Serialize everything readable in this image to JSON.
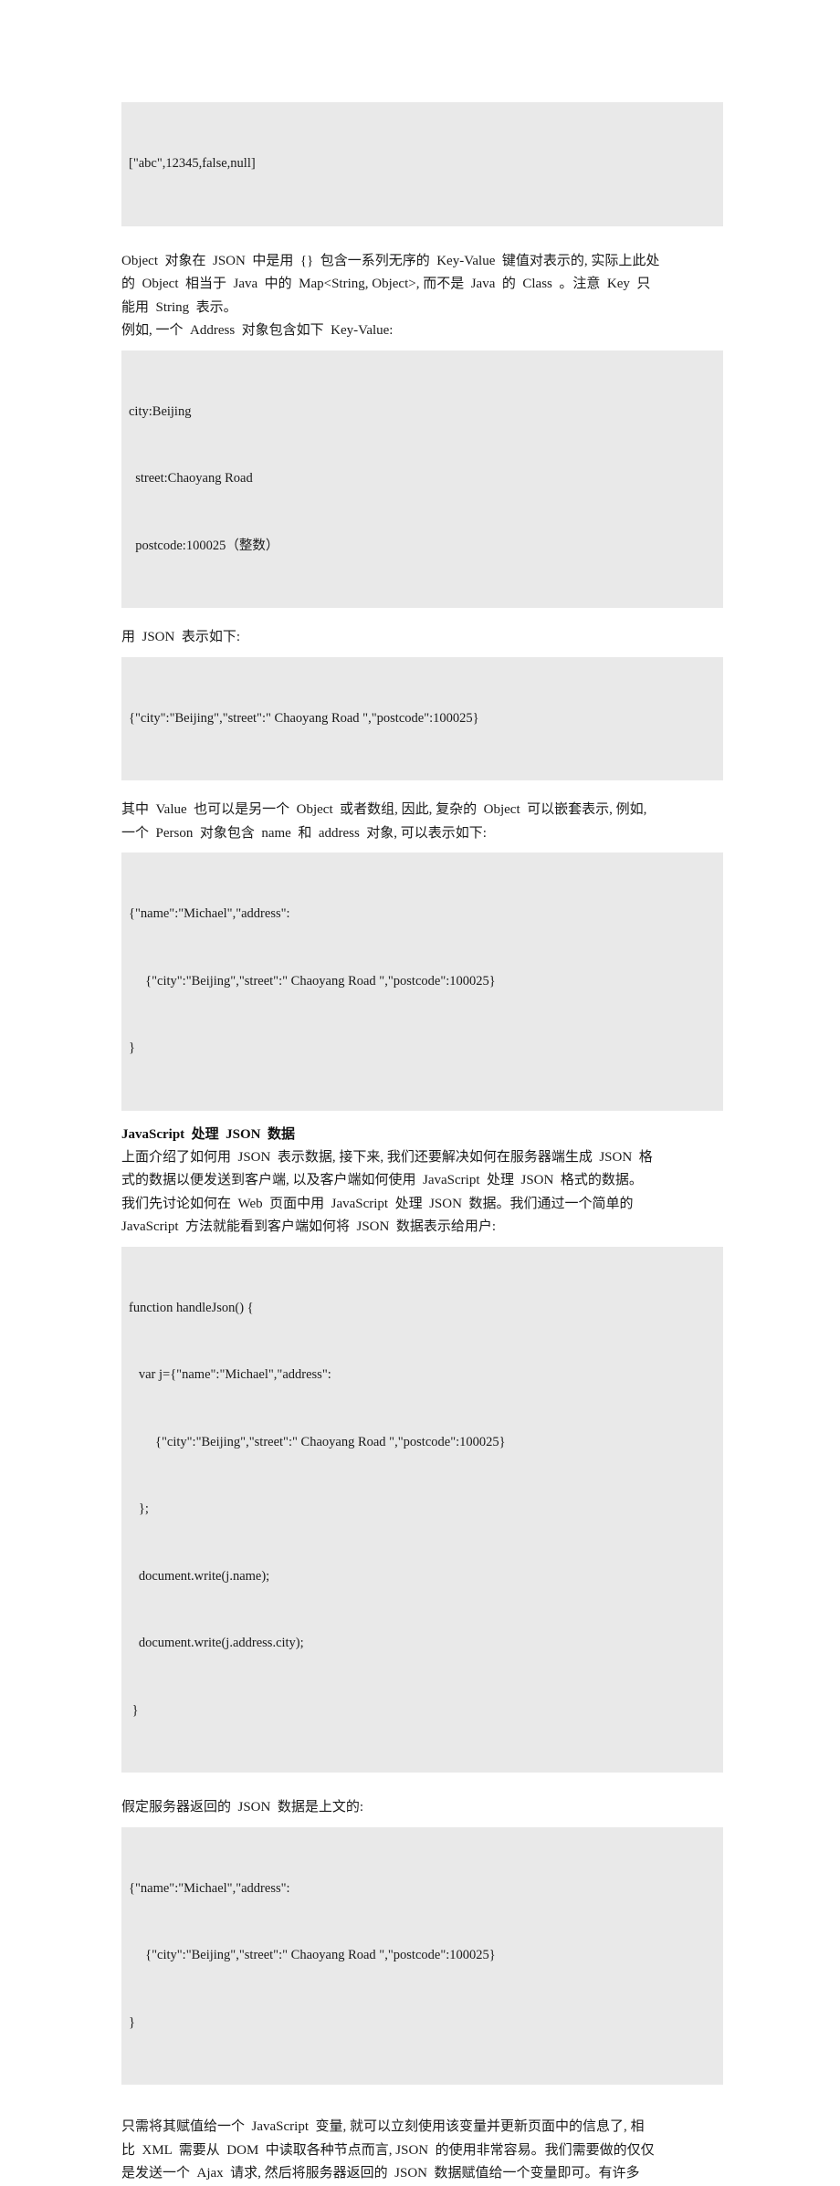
{
  "document": {
    "page_background": "#ffffff",
    "code_block_background": "#e9e9e9",
    "text_color": "#1a1a1a"
  },
  "blocks": {
    "array_example": {
      "line1": "[\"abc\",12345,false,null]"
    },
    "object_paragraph": {
      "line1": "Object  对象在  JSON  中是用  {}  包含一系列无序的  Key-Value  键值对表示的, 实际上此处",
      "line2": "的  Object  相当于  Java  中的  Map<String, Object>, 而不是  Java  的  Class  。注意  Key  只",
      "line3": "能用  String  表示。",
      "line4": "例如, 一个  Address  对象包含如下  Key-Value:"
    },
    "address_keyvalue": {
      "line1": "city:Beijing",
      "line2": "  street:Chaoyang Road",
      "line3": "  postcode:100025（整数）"
    },
    "json_intro": {
      "line1": "用  JSON  表示如下:"
    },
    "address_json": {
      "line1": "{\"city\":\"Beijing\",\"street\":\" Chaoyang Road \",\"postcode\":100025}"
    },
    "nested_paragraph": {
      "line1": "其中  Value  也可以是另一个  Object  或者数组, 因此, 复杂的  Object  可以嵌套表示, 例如,",
      "line2": "一个  Person  对象包含  name  和  address  对象, 可以表示如下:"
    },
    "person_json": {
      "line1": "{\"name\":\"Michael\",\"address\":",
      "line2": "     {\"city\":\"Beijing\",\"street\":\" Chaoyang Road \",\"postcode\":100025}",
      "line3": "}"
    },
    "javascript_heading": {
      "text": "JavaScript  处理  JSON  数据"
    },
    "javascript_paragraph": {
      "line1": "上面介绍了如何用  JSON  表示数据, 接下来, 我们还要解决如何在服务器端生成  JSON  格",
      "line2": "式的数据以便发送到客户端, 以及客户端如何使用  JavaScript  处理  JSON  格式的数据。",
      "line3": "我们先讨论如何在  Web  页面中用  JavaScript  处理  JSON  数据。我们通过一个简单的",
      "line4": "JavaScript  方法就能看到客户端如何将  JSON  数据表示给用户:"
    },
    "handle_json_code": {
      "line1": "function handleJson() {",
      "line2": "   var j={\"name\":\"Michael\",\"address\":",
      "line3": "        {\"city\":\"Beijing\",\"street\":\" Chaoyang Road \",\"postcode\":100025}",
      "line4": "   };",
      "line5": "   document.write(j.name);",
      "line6": "   document.write(j.address.city);",
      "line7": " }"
    },
    "server_return_intro": {
      "line1": "假定服务器返回的  JSON  数据是上文的:"
    },
    "server_return_json": {
      "line1": "{\"name\":\"Michael\",\"address\":",
      "line2": "     {\"city\":\"Beijing\",\"street\":\" Chaoyang Road \",\"postcode\":100025}",
      "line3": "}"
    },
    "closing_paragraph": {
      "line1": "只需将其赋值给一个  JavaScript  变量, 就可以立刻使用该变量并更新页面中的信息了, 相",
      "line2": "比  XML  需要从  DOM  中读取各种节点而言, JSON  的使用非常容易。我们需要做的仅仅",
      "line3": "是发送一个  Ajax  请求, 然后将服务器返回的  JSON  数据赋值给一个变量即可。有许多"
    }
  }
}
